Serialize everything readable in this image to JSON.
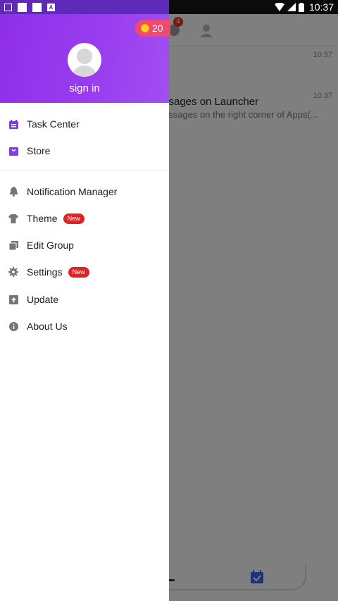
{
  "status_bar": {
    "time": "10:37"
  },
  "background": {
    "badge_count": "4",
    "rows": [
      {
        "time": "10:37",
        "title": "",
        "subtitle": ""
      },
      {
        "time": "10:37",
        "title": "ssages on Launcher",
        "subtitle": "essages on the right corner of Apps(..."
      }
    ]
  },
  "drawer": {
    "coins": "20",
    "sign_in": "sign in",
    "primary_items": [
      {
        "label": "Task Center",
        "icon": "calendar-icon"
      },
      {
        "label": "Store",
        "icon": "bag-icon"
      }
    ],
    "secondary_items": [
      {
        "label": "Notification Manager",
        "icon": "bell-icon",
        "badge": ""
      },
      {
        "label": "Theme",
        "icon": "tshirt-icon",
        "badge": "New"
      },
      {
        "label": "Edit Group",
        "icon": "stack-icon",
        "badge": ""
      },
      {
        "label": "Settings",
        "icon": "gear-icon",
        "badge": "New"
      },
      {
        "label": "Update",
        "icon": "upload-icon",
        "badge": ""
      },
      {
        "label": "About Us",
        "icon": "info-icon",
        "badge": ""
      }
    ]
  },
  "colors": {
    "header_purple": "#9a3ef0",
    "coin_pill": "#f04a6e",
    "badge_red": "#e02222",
    "primary_icon_purple": "#7b3fe4"
  }
}
